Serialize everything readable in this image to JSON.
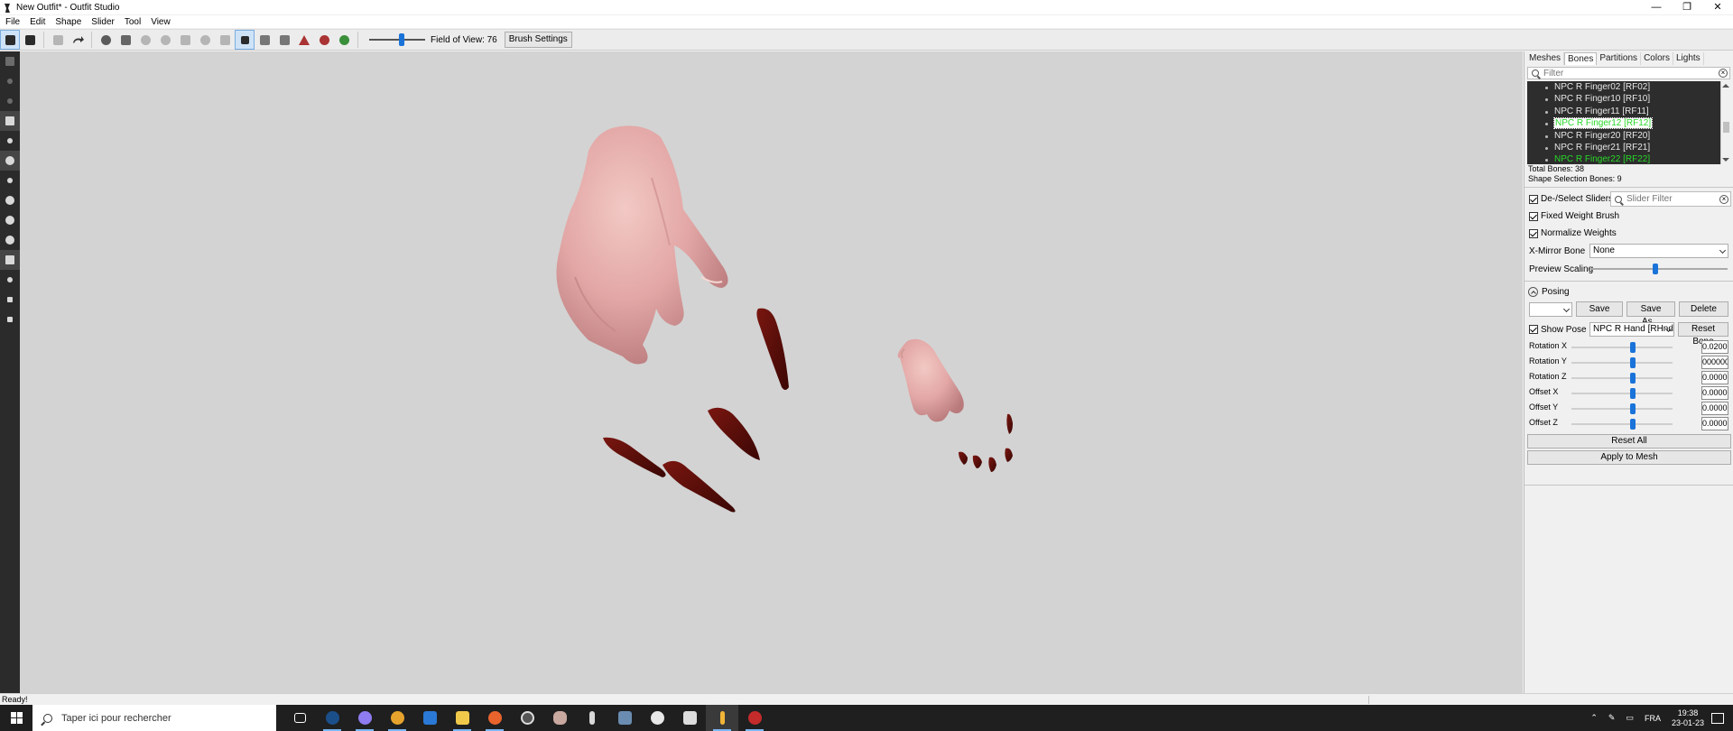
{
  "window": {
    "title": "New Outfit* - Outfit Studio",
    "controls": [
      "—",
      "❐",
      "✕"
    ]
  },
  "menu": [
    "File",
    "Edit",
    "Shape",
    "Slider",
    "Tool",
    "View"
  ],
  "toolbar": {
    "fov_label": "Field of View: 76",
    "brush_settings": "Brush Settings"
  },
  "right_panel": {
    "tabs": [
      "Meshes",
      "Bones",
      "Partitions",
      "Colors",
      "Lights"
    ],
    "active_tab": "Bones",
    "filter_placeholder": "Filter",
    "bones": [
      {
        "name": "NPC R Finger02 [RF02]",
        "state": "normal"
      },
      {
        "name": "NPC R Finger10 [RF10]",
        "state": "normal"
      },
      {
        "name": "NPC R Finger11 [RF11]",
        "state": "normal"
      },
      {
        "name": "NPC R Finger12 [RF12]",
        "state": "selected"
      },
      {
        "name": "NPC R Finger20 [RF20]",
        "state": "normal"
      },
      {
        "name": "NPC R Finger21 [RF21]",
        "state": "normal"
      },
      {
        "name": "NPC R Finger22 [RF22]",
        "state": "green"
      }
    ],
    "total_bones": "Total Bones: 38",
    "shape_selection_bones": "Shape Selection Bones: 9",
    "deselect_sliders": "De-/Select Sliders",
    "slider_filter_placeholder": "Slider Filter",
    "fixed_weight_brush": "Fixed Weight Brush",
    "normalize_weights": "Normalize Weights",
    "xmirror_label": "X-Mirror Bone",
    "xmirror_value": "None",
    "preview_scaling": "Preview Scaling",
    "preview_scaling_level": 0.46,
    "posing_label": "Posing",
    "pose_select_value": "",
    "save": "Save",
    "save_as": "Save As...",
    "delete": "Delete",
    "show_pose": "Show Pose",
    "pose_bone_value": "NPC R Hand [RHnd",
    "reset_bone": "Reset Bone",
    "sliders": [
      {
        "label": "Rotation X",
        "value": "0.0200"
      },
      {
        "label": "Rotation Y",
        "value": "000000"
      },
      {
        "label": "Rotation Z",
        "value": "0.0000"
      },
      {
        "label": "Offset X",
        "value": "0.0000"
      },
      {
        "label": "Offset Y",
        "value": "0.0000"
      },
      {
        "label": "Offset Z",
        "value": "0.0000"
      }
    ],
    "reset_all": "Reset All",
    "apply_to_mesh": "Apply to Mesh"
  },
  "status": {
    "text": "Ready!"
  },
  "taskbar": {
    "search_placeholder": "Taper ici pour rechercher",
    "lang": "FRA",
    "time": "19:38",
    "date": "23-01-23",
    "apps": [
      "task-view",
      "steam",
      "discord",
      "chrome",
      "notepad",
      "file-explorer",
      "firefox",
      "media-app",
      "brain-app",
      "outfit-studio-alt",
      "vm-app",
      "settings",
      "gallery",
      "outfit-studio",
      "record-app"
    ]
  },
  "colors": {
    "accent": "#1a73d9",
    "viewport_bg": "#d3d3d3",
    "bone_list_bg": "#2d2d2d",
    "bone_green": "#28d828",
    "skin": "#e9b0ac",
    "nail": "#5a0d08"
  }
}
